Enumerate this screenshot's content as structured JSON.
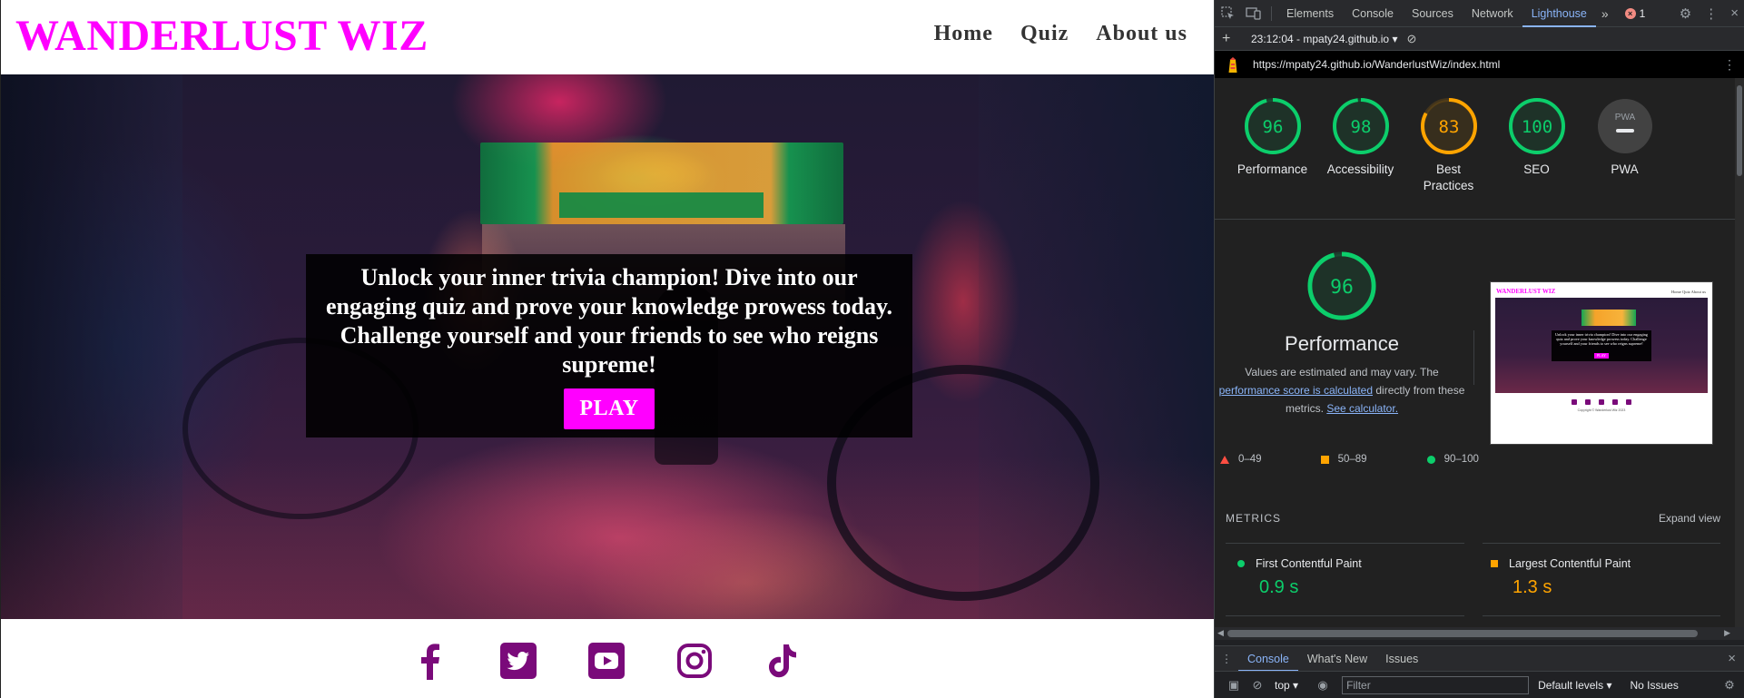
{
  "site": {
    "brand": "WANDERLUST WIZ",
    "nav": [
      "Home",
      "Quiz",
      "About us"
    ],
    "hero_text": "Unlock your inner trivia champion! Dive into our engaging quiz and prove your knowledge prowess today. Challenge yourself and your friends to see who reigns supreme!",
    "play_label": "PLAY",
    "social_icons": [
      "facebook-icon",
      "twitter-icon",
      "youtube-icon",
      "instagram-icon",
      "tiktok-icon"
    ],
    "colors": {
      "brand": "#ff00ff",
      "social": "#7a0a7a"
    }
  },
  "devtools": {
    "tabs": [
      "Elements",
      "Console",
      "Sources",
      "Network",
      "Lighthouse"
    ],
    "active_tab": "Lighthouse",
    "error_count": "1",
    "report_label": "23:12:04 - mpaty24.github.io",
    "url": "https://mpaty24.github.io/WanderlustWiz/index.html",
    "scores": [
      {
        "label": "Performance",
        "value": "96",
        "color": "#0cce6b"
      },
      {
        "label": "Accessibility",
        "value": "98",
        "color": "#0cce6b"
      },
      {
        "label": "Best Practices",
        "value": "83",
        "color": "#ffa400"
      },
      {
        "label": "SEO",
        "value": "100",
        "color": "#0cce6b"
      },
      {
        "label": "PWA",
        "value": "",
        "color": "#9aa0a6"
      }
    ],
    "pwa_badge": "PWA",
    "performance": {
      "score": "96",
      "title": "Performance",
      "desc_prefix": "Values are estimated and may vary. The",
      "desc_link": "performance score is calculated",
      "desc_mid": "directly from these metrics.",
      "calc_link": "See calculator."
    },
    "thumbnail": {
      "brand": "WANDERLUST WIZ",
      "nav": "Home   Quiz   About us",
      "text": "Unlock your inner trivia champion! Dive into our engaging quiz and prove your knowledge prowess today. Challenge yourself and your friends to see who reigns supreme!",
      "play": "PLAY",
      "copyright": "Copyright © Wanderlust Wiz 2023"
    },
    "legend": [
      "0–49",
      "50–89",
      "90–100"
    ],
    "metrics_title": "METRICS",
    "expand_view": "Expand view",
    "metrics": [
      {
        "name": "First Contentful Paint",
        "value": "0.9 s",
        "color": "#0cce6b"
      },
      {
        "name": "Largest Contentful Paint",
        "value": "1.3 s",
        "color": "#ffa400"
      }
    ],
    "drawer_tabs": [
      "Console",
      "What's New",
      "Issues"
    ],
    "console": {
      "context": "top",
      "filter_placeholder": "Filter",
      "levels": "Default levels",
      "issues": "No Issues"
    }
  }
}
